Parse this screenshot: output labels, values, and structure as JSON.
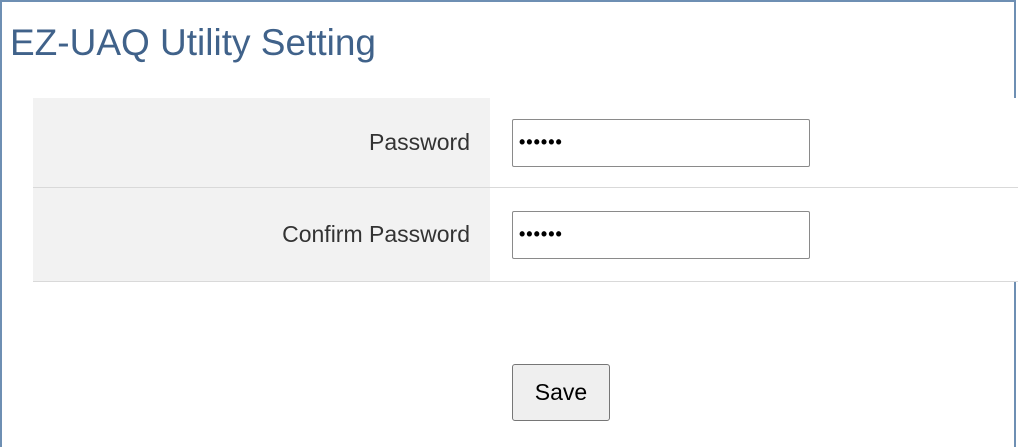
{
  "page": {
    "title": "EZ-UAQ Utility Setting"
  },
  "form": {
    "password": {
      "label": "Password",
      "value": "••••••"
    },
    "confirm_password": {
      "label": "Confirm Password",
      "value": "••••••"
    },
    "save_label": "Save"
  }
}
